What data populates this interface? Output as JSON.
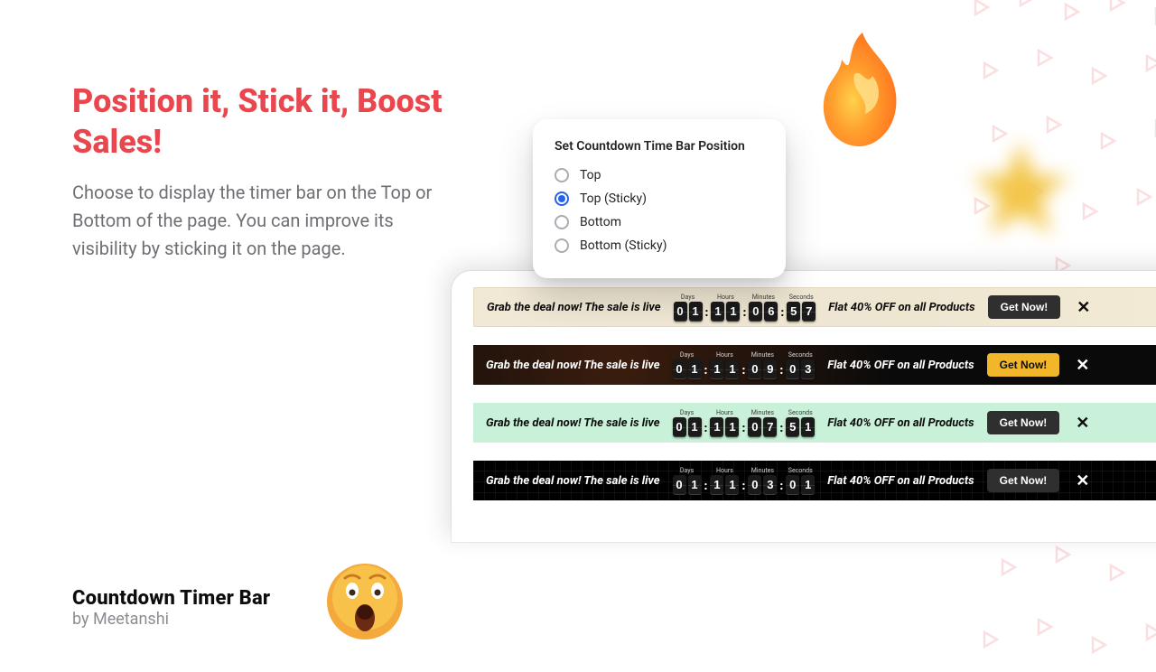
{
  "hero": {
    "title": "Position it, Stick it, Boost Sales!",
    "description": "Choose to display the timer bar on the Top or Bottom of the page. You can improve its visibility by sticking it on the page."
  },
  "brand": {
    "name": "Countdown Timer Bar",
    "by": "by Meetanshi"
  },
  "settings": {
    "title": "Set Countdown Time Bar Position",
    "options": [
      "Top",
      "Top (Sticky)",
      "Bottom",
      "Bottom (Sticky)"
    ],
    "selected_index": 1
  },
  "timer_labels": {
    "days": "Days",
    "hours": "Hours",
    "minutes": "Minutes",
    "seconds": "Seconds"
  },
  "bars": [
    {
      "message": "Grab the deal now! The sale is live",
      "offer": "Flat 40% OFF on all Products",
      "cta": "Get Now!",
      "time": {
        "days": "01",
        "hours": "11",
        "minutes": "06",
        "seconds": "57"
      }
    },
    {
      "message": "Grab the deal now! The sale is live",
      "offer": "Flat 40% OFF on all Products",
      "cta": "Get Now!",
      "time": {
        "days": "01",
        "hours": "11",
        "minutes": "09",
        "seconds": "03"
      }
    },
    {
      "message": "Grab the deal now! The sale is live",
      "offer": "Flat 40% OFF on all Products",
      "cta": "Get Now!",
      "time": {
        "days": "01",
        "hours": "11",
        "minutes": "07",
        "seconds": "51"
      }
    },
    {
      "message": "Grab the deal now! The sale is live",
      "offer": "Flat 40% OFF on all Products",
      "cta": "Get Now!",
      "time": {
        "days": "01",
        "hours": "11",
        "minutes": "03",
        "seconds": "01"
      }
    }
  ]
}
